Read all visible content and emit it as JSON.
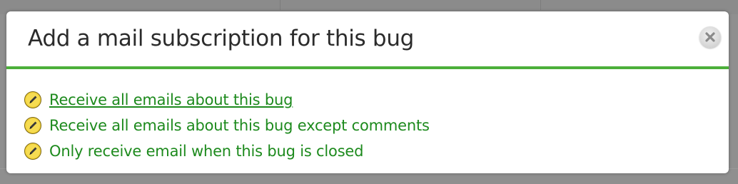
{
  "dialog": {
    "title": "Add a mail subscription for this bug",
    "close_icon": "close-icon",
    "accent_color": "#4caf3a",
    "link_color": "#1d8a1d"
  },
  "options": [
    {
      "label": "Receive all emails about this bug",
      "icon": "pencil-edit-icon",
      "hovered": true
    },
    {
      "label": "Receive all emails about this bug except comments",
      "icon": "pencil-edit-icon",
      "hovered": false
    },
    {
      "label": "Only receive email when this bug is closed",
      "icon": "pencil-edit-icon",
      "hovered": false
    }
  ]
}
